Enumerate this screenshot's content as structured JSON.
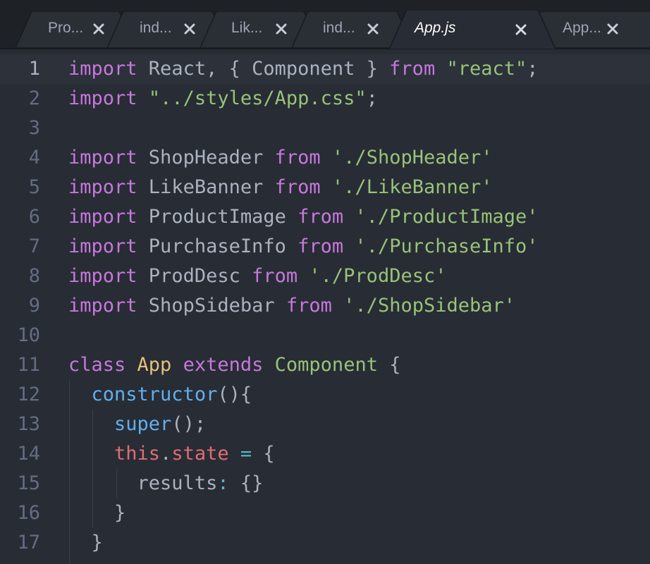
{
  "tabs": [
    {
      "label": "Pro...",
      "active": false
    },
    {
      "label": "ind...",
      "active": false
    },
    {
      "label": "Lik...",
      "active": false
    },
    {
      "label": "ind...",
      "active": false
    },
    {
      "label": "App.js",
      "active": true
    },
    {
      "label": "App...",
      "active": false
    }
  ],
  "icons": {
    "close": "close-icon"
  },
  "colors": {
    "editor_bg": "#282c34",
    "tabbar_bg": "#1e2126",
    "keyword": "#c678dd",
    "string": "#98c379",
    "class_name": "#e5c07b",
    "function": "#61afef",
    "this_keyword": "#e06c75",
    "operator": "#56b6c2",
    "plain": "#abb2bf",
    "line_number": "#636d83"
  },
  "editor": {
    "current_line": 1,
    "lines": [
      {
        "number": "1",
        "tokens": [
          [
            "kw",
            "import"
          ],
          [
            "plain",
            " React, { Component } "
          ],
          [
            "kw",
            "from"
          ],
          [
            "plain",
            " "
          ],
          [
            "str",
            "\"react\""
          ],
          [
            "plain",
            ";"
          ]
        ]
      },
      {
        "number": "2",
        "tokens": [
          [
            "kw",
            "import"
          ],
          [
            "plain",
            " "
          ],
          [
            "str",
            "\"../styles/App.css\""
          ],
          [
            "plain",
            ";"
          ]
        ]
      },
      {
        "number": "3",
        "tokens": []
      },
      {
        "number": "4",
        "tokens": [
          [
            "kw",
            "import"
          ],
          [
            "plain",
            " ShopHeader "
          ],
          [
            "kw",
            "from"
          ],
          [
            "plain",
            " "
          ],
          [
            "str",
            "'./ShopHeader'"
          ]
        ]
      },
      {
        "number": "5",
        "tokens": [
          [
            "kw",
            "import"
          ],
          [
            "plain",
            " LikeBanner "
          ],
          [
            "kw",
            "from"
          ],
          [
            "plain",
            " "
          ],
          [
            "str",
            "'./LikeBanner'"
          ]
        ]
      },
      {
        "number": "6",
        "tokens": [
          [
            "kw",
            "import"
          ],
          [
            "plain",
            " ProductImage "
          ],
          [
            "kw",
            "from"
          ],
          [
            "plain",
            " "
          ],
          [
            "str",
            "'./ProductImage'"
          ]
        ]
      },
      {
        "number": "7",
        "tokens": [
          [
            "kw",
            "import"
          ],
          [
            "plain",
            " PurchaseInfo "
          ],
          [
            "kw",
            "from"
          ],
          [
            "plain",
            " "
          ],
          [
            "str",
            "'./PurchaseInfo'"
          ]
        ]
      },
      {
        "number": "8",
        "tokens": [
          [
            "kw",
            "import"
          ],
          [
            "plain",
            " ProdDesc "
          ],
          [
            "kw",
            "from"
          ],
          [
            "plain",
            " "
          ],
          [
            "str",
            "'./ProdDesc'"
          ]
        ]
      },
      {
        "number": "9",
        "tokens": [
          [
            "kw",
            "import"
          ],
          [
            "plain",
            " ShopSidebar "
          ],
          [
            "kw",
            "from"
          ],
          [
            "plain",
            " "
          ],
          [
            "str",
            "'./ShopSidebar'"
          ]
        ]
      },
      {
        "number": "10",
        "tokens": []
      },
      {
        "number": "11",
        "tokens": [
          [
            "kw",
            "class"
          ],
          [
            "plain",
            " "
          ],
          [
            "cls",
            "App"
          ],
          [
            "plain",
            " "
          ],
          [
            "kw",
            "extends"
          ],
          [
            "plain",
            " "
          ],
          [
            "inh",
            "Component"
          ],
          [
            "plain",
            " {"
          ]
        ]
      },
      {
        "number": "12",
        "tokens": [
          [
            "plain",
            "  "
          ],
          [
            "fn",
            "constructor"
          ],
          [
            "plain",
            "(){"
          ]
        ]
      },
      {
        "number": "13",
        "tokens": [
          [
            "plain",
            "    "
          ],
          [
            "fn",
            "super"
          ],
          [
            "plain",
            "();"
          ]
        ]
      },
      {
        "number": "14",
        "tokens": [
          [
            "plain",
            "    "
          ],
          [
            "thisk",
            "this"
          ],
          [
            "plain",
            "."
          ],
          [
            "prop",
            "state"
          ],
          [
            "plain",
            " "
          ],
          [
            "op",
            "="
          ],
          [
            "plain",
            " {"
          ]
        ]
      },
      {
        "number": "15",
        "tokens": [
          [
            "plain",
            "      results"
          ],
          [
            "op",
            ":"
          ],
          [
            "plain",
            " {}"
          ]
        ]
      },
      {
        "number": "16",
        "tokens": [
          [
            "plain",
            "    }"
          ]
        ]
      },
      {
        "number": "17",
        "tokens": [
          [
            "plain",
            "  }"
          ]
        ]
      }
    ]
  }
}
